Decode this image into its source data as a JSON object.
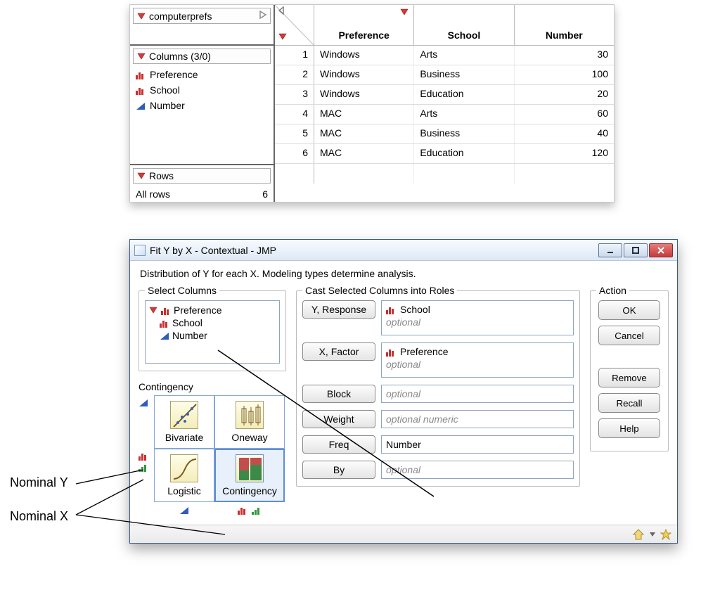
{
  "datatable": {
    "name": "computerprefs",
    "columns_header": "Columns (3/0)",
    "columns": [
      {
        "name": "Preference",
        "type": "nominal"
      },
      {
        "name": "School",
        "type": "nominal"
      },
      {
        "name": "Number",
        "type": "continuous"
      }
    ],
    "rows_header": "Rows",
    "rows_label": "All rows",
    "rows_count": "6",
    "headers": [
      "Preference",
      "School",
      "Number"
    ],
    "rows": [
      {
        "n": "1",
        "Preference": "Windows",
        "School": "Arts",
        "Number": "30"
      },
      {
        "n": "2",
        "Preference": "Windows",
        "School": "Business",
        "Number": "100"
      },
      {
        "n": "3",
        "Preference": "Windows",
        "School": "Education",
        "Number": "20"
      },
      {
        "n": "4",
        "Preference": "MAC",
        "School": "Arts",
        "Number": "60"
      },
      {
        "n": "5",
        "Preference": "MAC",
        "School": "Business",
        "Number": "40"
      },
      {
        "n": "6",
        "Preference": "MAC",
        "School": "Education",
        "Number": "120"
      }
    ]
  },
  "dialog": {
    "title": "Fit Y by X - Contextual - JMP",
    "description": "Distribution of Y for each X. Modeling types determine analysis.",
    "select_columns_label": "Select Columns",
    "select_columns": [
      {
        "name": "Preference",
        "type": "nominal"
      },
      {
        "name": "School",
        "type": "nominal"
      },
      {
        "name": "Number",
        "type": "continuous"
      }
    ],
    "contingency": {
      "label": "Contingency",
      "cells": {
        "bivariate": "Bivariate",
        "oneway": "Oneway",
        "logistic": "Logistic",
        "contingency": "Contingency"
      }
    },
    "cast_label": "Cast Selected Columns into Roles",
    "roles": {
      "y": {
        "button": "Y, Response",
        "assigned": "School",
        "assigned_type": "nominal",
        "optional": "optional"
      },
      "x": {
        "button": "X, Factor",
        "assigned": "Preference",
        "assigned_type": "nominal",
        "optional": "optional"
      },
      "block": {
        "button": "Block",
        "optional": "optional"
      },
      "weight": {
        "button": "Weight",
        "optional": "optional numeric"
      },
      "freq": {
        "button": "Freq",
        "assigned": "Number"
      },
      "by": {
        "button": "By",
        "optional": "optional"
      }
    },
    "action_label": "Action",
    "actions": {
      "ok": "OK",
      "cancel": "Cancel",
      "remove": "Remove",
      "recall": "Recall",
      "help": "Help"
    }
  },
  "annotations": {
    "nominal_y": "Nominal Y",
    "nominal_x": "Nominal X"
  }
}
